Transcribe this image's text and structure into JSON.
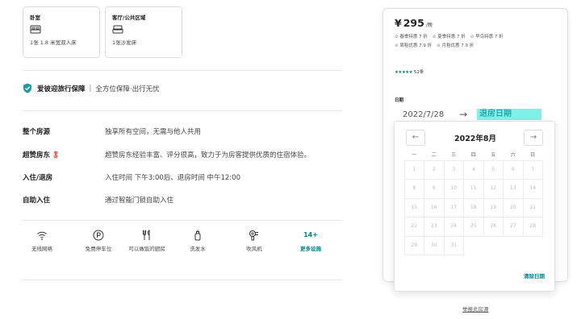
{
  "rooms": [
    {
      "title": "卧室",
      "desc": "1张 1.8 米宽双人床",
      "icon": "bed-icon"
    },
    {
      "title": "客厅/公共区域",
      "desc": "1张沙发床",
      "icon": "sofa-bed-icon"
    }
  ],
  "guarantee": {
    "brand": "爱彼迎旅行保障",
    "separator": "|",
    "subtitle": "全方位保障·出行无忧",
    "icon": "shield-check-icon"
  },
  "features": [
    {
      "label": "整个房源",
      "text": "独享所有空间，无需与他人共用"
    },
    {
      "label": "超赞房东",
      "text": "超赞房东经验丰富、评分很高，致力于为房客提供优质的住宿体验。",
      "icon": "medal-icon"
    },
    {
      "label": "入住/退房",
      "text": "入住时间 下午3:00后、退房时间 中午12:00"
    },
    {
      "label": "自助入住",
      "text": "通过智能门锁自助入住"
    }
  ],
  "amenities": [
    {
      "label": "无线网络",
      "icon": "wifi-icon"
    },
    {
      "label": "免费停车位",
      "icon": "parking-icon"
    },
    {
      "label": "可以做饭的厨房",
      "icon": "kitchen-utensils-icon"
    },
    {
      "label": "洗发水",
      "icon": "shampoo-icon"
    },
    {
      "label": "吹风机",
      "icon": "hair-dryer-icon"
    }
  ],
  "more_amenities": {
    "count": "14+",
    "label": "更多设施"
  },
  "booking": {
    "currency": "¥",
    "price": "295",
    "unit": "/晚",
    "discounts": [
      "春季特惠 7 折",
      "夏季特惠 7 折",
      "早鸟特惠 7 折",
      "周租优惠 7.9 折",
      "月租优惠 7.9 折"
    ],
    "stars": "★★★★★",
    "review_count": "52条",
    "date_label": "日期",
    "checkin": "2022/7/28",
    "arrow": "→",
    "checkout_placeholder": "退房日期"
  },
  "calendar": {
    "title": "2022年8月",
    "prev": "←",
    "next": "→",
    "weekdays": [
      "一",
      "二",
      "三",
      "四",
      "五",
      "六",
      "日"
    ],
    "days": [
      "1",
      "2",
      "3",
      "4",
      "5",
      "6",
      "7",
      "8",
      "9",
      "10",
      "11",
      "12",
      "13",
      "14",
      "15",
      "16",
      "17",
      "18",
      "19",
      "20",
      "21",
      "22",
      "23",
      "24",
      "25",
      "26",
      "27",
      "28",
      "29",
      "30",
      "31"
    ],
    "clear_label": "清除日期"
  },
  "report_link": "举报此房源"
}
